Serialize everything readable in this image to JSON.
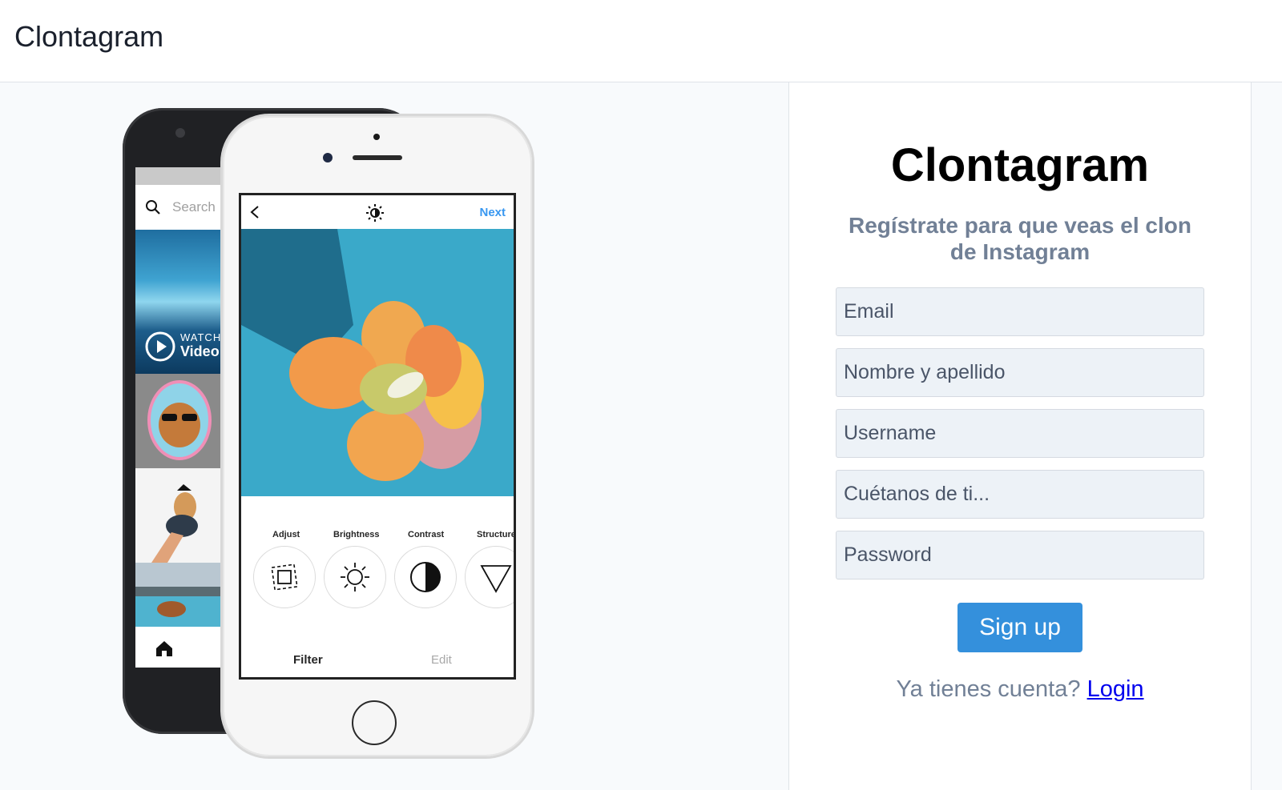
{
  "header": {
    "brand": "Clontagram"
  },
  "showcase": {
    "back_phone": {
      "search_placeholder": "Search",
      "watch_line1": "WATCH",
      "watch_line2": "Video"
    },
    "front_phone": {
      "next_label": "Next",
      "tools": [
        "Adjust",
        "Brightness",
        "Contrast",
        "Structure"
      ],
      "tab_filter": "Filter",
      "tab_edit": "Edit"
    }
  },
  "signup": {
    "title": "Clontagram",
    "subtitle": "Regístrate para que veas el clon de Instagram",
    "fields": {
      "email": "Email",
      "name": "Nombre y apellido",
      "username": "Username",
      "bio": "Cuétanos de ti...",
      "password": "Password"
    },
    "submit_label": "Sign up",
    "login_prompt": "Ya tienes cuenta?",
    "login_link": "Login"
  },
  "colors": {
    "accent_button": "#3490dc",
    "subtitle_gray": "#718096",
    "link_blue": "#0000ee",
    "next_blue": "#3897f0"
  }
}
